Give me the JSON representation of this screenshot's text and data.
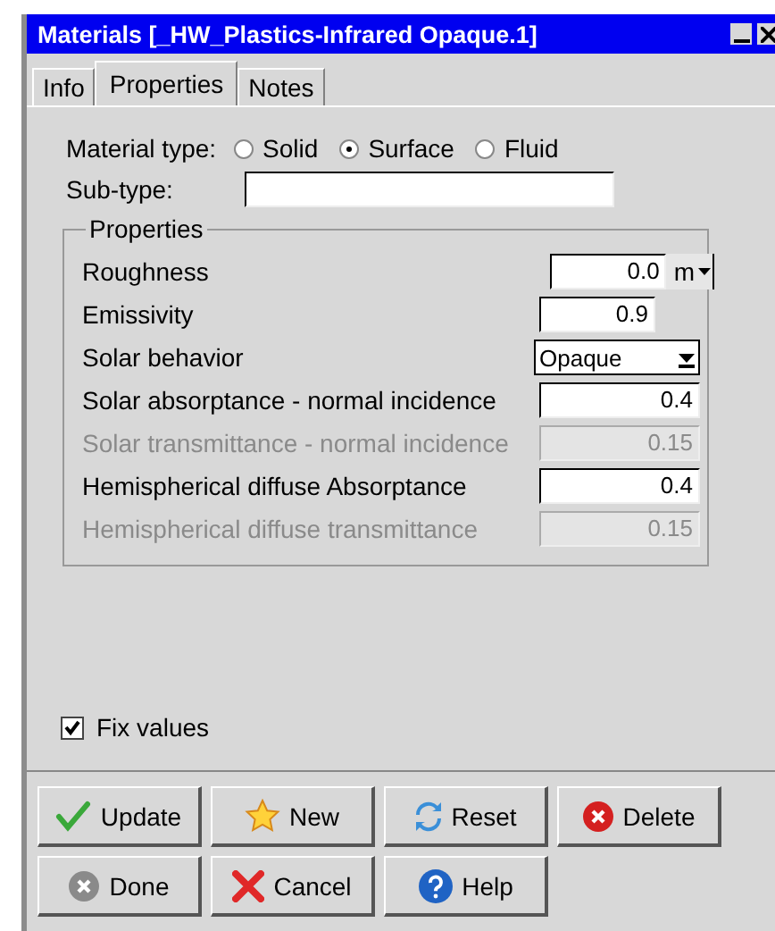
{
  "window": {
    "title": "Materials [_HW_Plastics-Infrared Opaque.1]"
  },
  "tabs": [
    {
      "label": "Info",
      "selected": false
    },
    {
      "label": "Properties",
      "selected": true
    },
    {
      "label": "Notes",
      "selected": false
    }
  ],
  "material_type": {
    "label": "Material type:",
    "options": [
      {
        "label": "Solid",
        "selected": false
      },
      {
        "label": "Surface",
        "selected": true
      },
      {
        "label": "Fluid",
        "selected": false
      }
    ]
  },
  "sub_type": {
    "label": "Sub-type:"
  },
  "properties": {
    "title": "Properties",
    "rows": [
      {
        "kind": "number",
        "label": "Roughness",
        "value": "0.0",
        "unit": "m",
        "disabled": false
      },
      {
        "kind": "number",
        "label": "Emissivity",
        "value": "0.9",
        "disabled": false
      },
      {
        "kind": "select",
        "label": "Solar behavior",
        "value": "Opaque",
        "disabled": false
      },
      {
        "kind": "number",
        "label": "Solar absorptance - normal incidence",
        "value": "0.4",
        "disabled": false
      },
      {
        "kind": "number",
        "label": "Solar transmittance - normal incidence",
        "value": "0.15",
        "disabled": true
      },
      {
        "kind": "number",
        "label": "Hemispherical diffuse Absorptance",
        "value": "0.4",
        "disabled": false
      },
      {
        "kind": "number",
        "label": "Hemispherical diffuse transmittance",
        "value": "0.15",
        "disabled": true
      }
    ]
  },
  "fix_values": {
    "label": "Fix values",
    "checked": true
  },
  "buttons": [
    {
      "kind": "update",
      "label": "Update"
    },
    {
      "kind": "new",
      "label": "New"
    },
    {
      "kind": "reset",
      "label": "Reset"
    },
    {
      "kind": "delete",
      "label": "Delete"
    },
    {
      "kind": "done",
      "label": "Done"
    },
    {
      "kind": "cancel",
      "label": "Cancel"
    },
    {
      "kind": "help",
      "label": "Help"
    }
  ]
}
